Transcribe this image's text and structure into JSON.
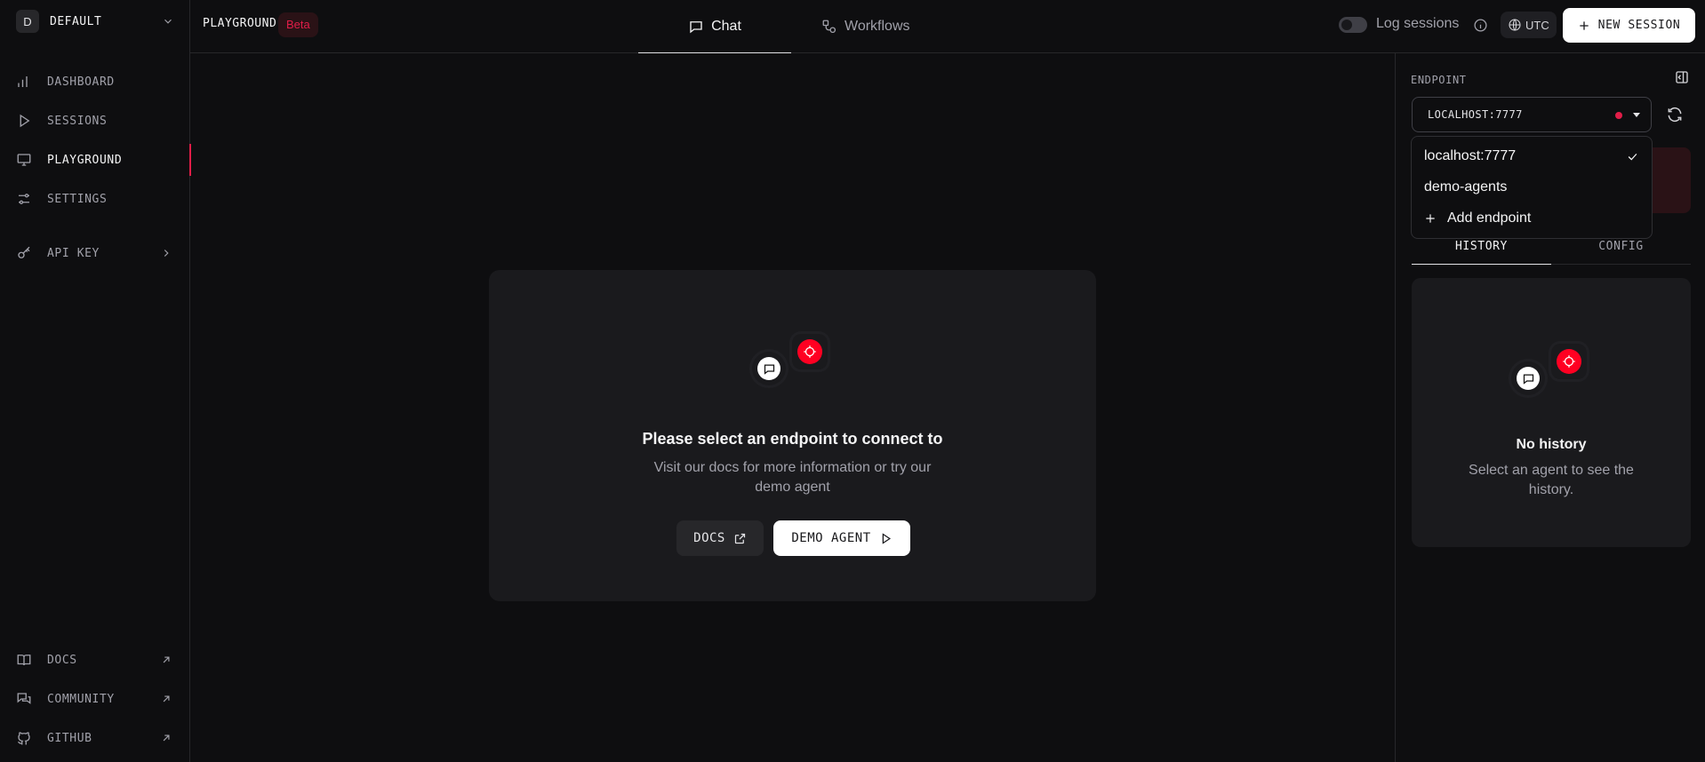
{
  "sidebar": {
    "workspace": {
      "initial": "D",
      "name": "DEFAULT"
    },
    "nav": [
      {
        "label": "DASHBOARD",
        "icon": "bar-chart-icon"
      },
      {
        "label": "SESSIONS",
        "icon": "play-icon"
      },
      {
        "label": "PLAYGROUND",
        "icon": "monitor-icon",
        "active": true
      },
      {
        "label": "SETTINGS",
        "icon": "sliders-icon"
      }
    ],
    "api_key": {
      "label": "API KEY",
      "icon": "key-icon"
    },
    "footer": [
      {
        "label": "DOCS",
        "icon": "book-icon"
      },
      {
        "label": "COMMUNITY",
        "icon": "messages-icon"
      },
      {
        "label": "GITHUB",
        "icon": "github-icon"
      }
    ]
  },
  "header": {
    "page_label": "PLAYGROUND",
    "badge": "Beta",
    "tabs": [
      {
        "label": "Chat",
        "active": true
      },
      {
        "label": "Workflows",
        "active": false
      }
    ],
    "log_sessions_label": "Log sessions",
    "log_sessions_on": false,
    "timezone": "UTC",
    "new_session_label": "NEW SESSION"
  },
  "main": {
    "empty_title": "Please select an endpoint to connect to",
    "empty_subtitle": "Visit our docs for more information or try our demo agent",
    "docs_button": "DOCS",
    "demo_button": "DEMO AGENT"
  },
  "right_panel": {
    "endpoint_label": "ENDPOINT",
    "endpoint_value": "LOCALHOST:7777",
    "endpoint_status_color": "#e11d48",
    "dropdown": {
      "options": [
        "localhost:7777",
        "demo-agents"
      ],
      "selected": "localhost:7777",
      "add_label": "Add endpoint"
    },
    "tabs": [
      {
        "label": "HISTORY",
        "active": true
      },
      {
        "label": "CONFIG",
        "active": false
      }
    ],
    "history_empty_title": "No history",
    "history_empty_subtitle": "Select an agent to see the history."
  },
  "colors": {
    "accent": "#e11d48",
    "background": "#0e0e10",
    "card": "#1a1a1d",
    "brand_red": "#ff0022"
  }
}
